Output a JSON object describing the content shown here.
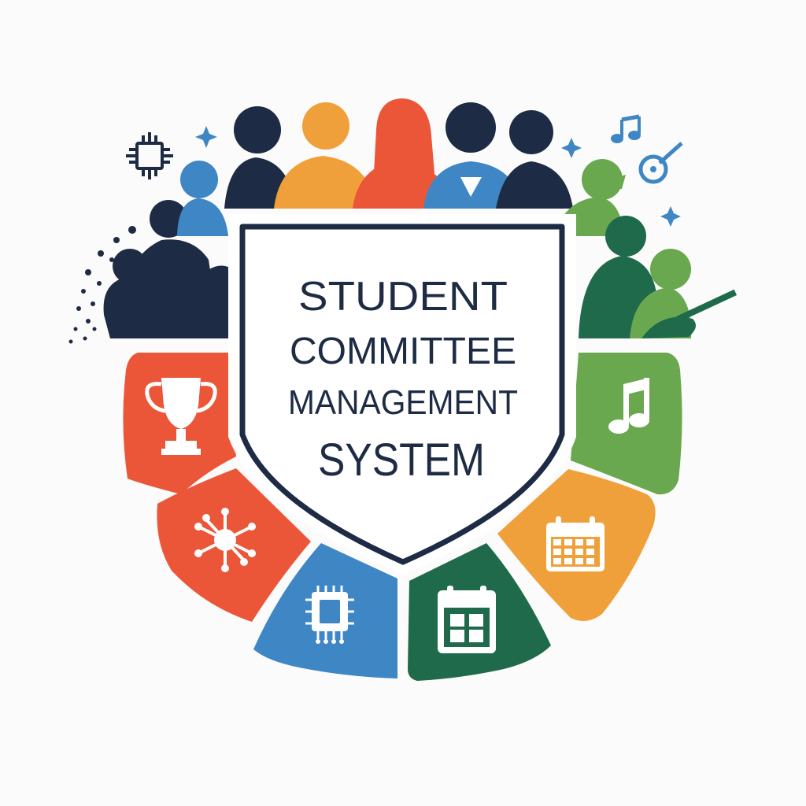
{
  "logo": {
    "title_lines": [
      "STUDENT",
      "COMMITTEE",
      "MANAGEMENT",
      "SYSTEM"
    ]
  },
  "colors": {
    "navy": "#1d2b44",
    "blue": "#3f86c4",
    "orange": "#f0a03a",
    "red": "#ec5638",
    "green_light": "#6aa84f",
    "green_dark": "#1f6a4b",
    "white": "#ffffff"
  },
  "segments": [
    {
      "name": "red-trophy-segment",
      "color": "red",
      "icon": "trophy-icon"
    },
    {
      "name": "red-network-segment",
      "color": "red",
      "icon": "network-icon"
    },
    {
      "name": "blue-chip-segment",
      "color": "blue",
      "icon": "chip-icon"
    },
    {
      "name": "dark-green-calendar-segment",
      "color": "green_dark",
      "icon": "calendar-icon"
    },
    {
      "name": "orange-calendar-segment",
      "color": "orange",
      "icon": "calendar-grid-icon"
    },
    {
      "name": "light-green-music-segment",
      "color": "green_light",
      "icon": "music-note-icon"
    }
  ],
  "decorations": [
    "circuit-chip-icon",
    "sparkle-icon",
    "music-notes-icon",
    "guitar-icon",
    "dot-trail"
  ]
}
